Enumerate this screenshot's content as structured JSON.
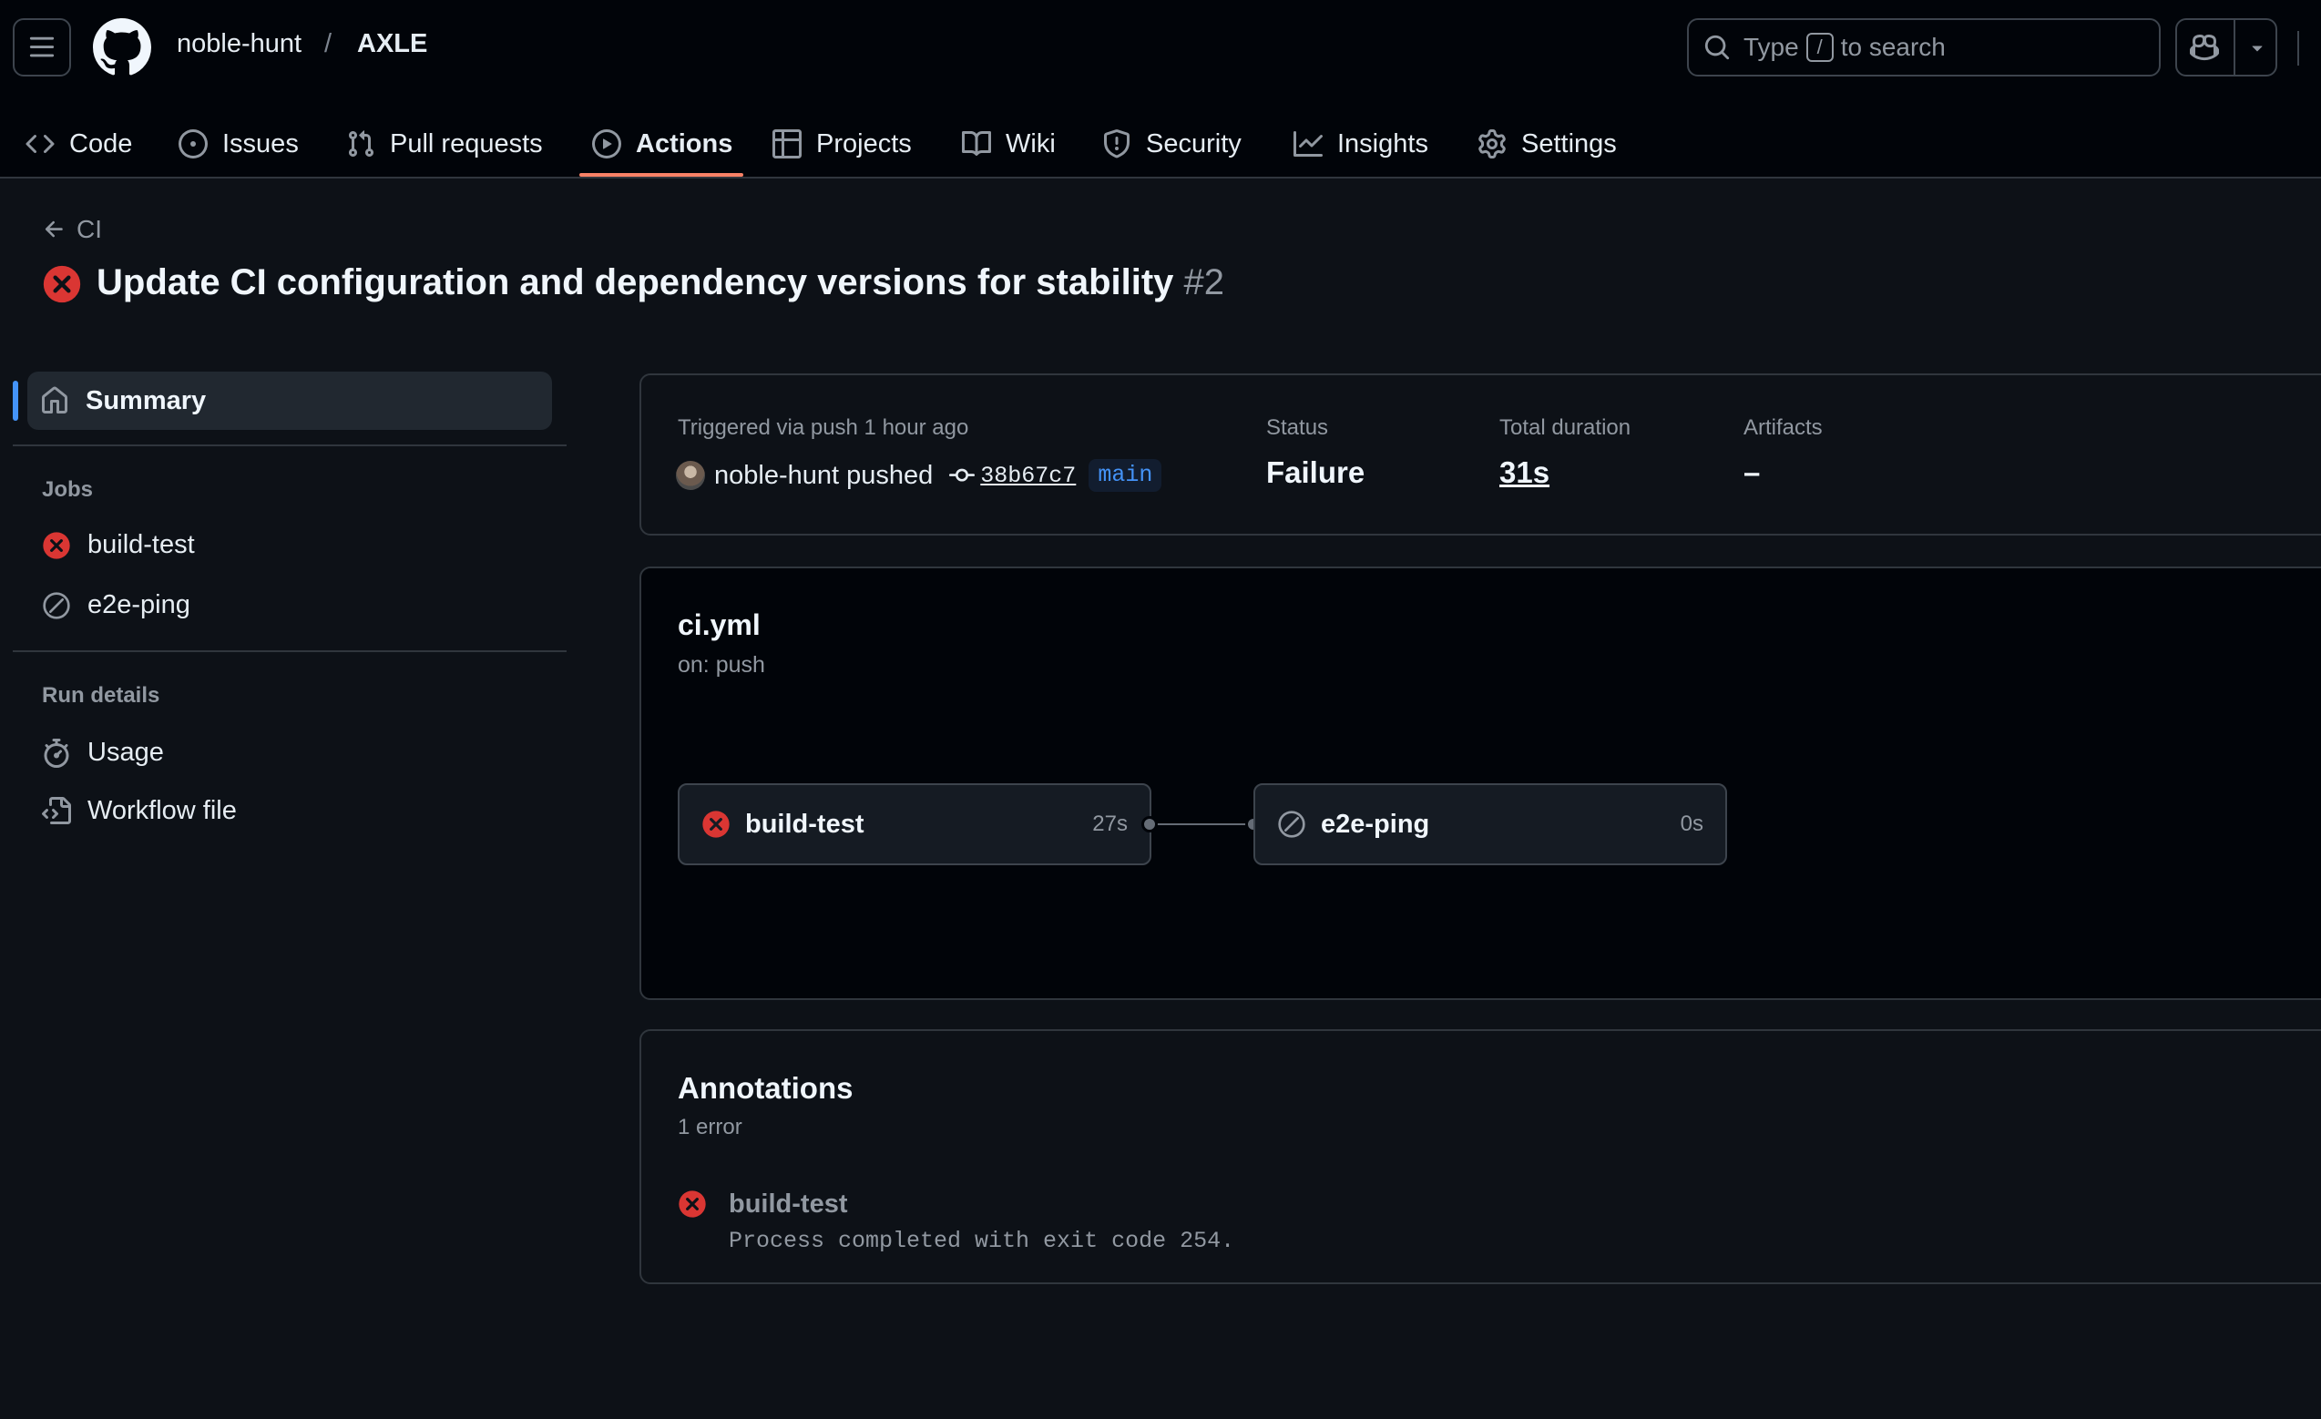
{
  "header": {
    "owner": "noble-hunt",
    "separator": "/",
    "repo": "AXLE",
    "search_text_before": "Type",
    "search_key": "/",
    "search_text_after": "to search"
  },
  "nav": {
    "tabs": [
      {
        "label": "Code",
        "icon": "code-icon"
      },
      {
        "label": "Issues",
        "icon": "issue-icon"
      },
      {
        "label": "Pull requests",
        "icon": "pull-request-icon"
      },
      {
        "label": "Actions",
        "icon": "play-icon",
        "active": true
      },
      {
        "label": "Projects",
        "icon": "table-icon"
      },
      {
        "label": "Wiki",
        "icon": "book-icon"
      },
      {
        "label": "Security",
        "icon": "shield-icon"
      },
      {
        "label": "Insights",
        "icon": "graph-icon"
      },
      {
        "label": "Settings",
        "icon": "gear-icon"
      }
    ]
  },
  "run": {
    "back_label": "CI",
    "title": "Update CI configuration and dependency versions for stability",
    "number": "#2"
  },
  "sidebar": {
    "summary": "Summary",
    "jobs_heading": "Jobs",
    "jobs": [
      {
        "label": "build-test",
        "status": "failure"
      },
      {
        "label": "e2e-ping",
        "status": "skipped"
      }
    ],
    "details_heading": "Run details",
    "details": [
      {
        "label": "Usage",
        "icon": "stopwatch-icon"
      },
      {
        "label": "Workflow file",
        "icon": "file-code-icon"
      }
    ]
  },
  "summary": {
    "triggered_label": "Triggered via push 1 hour ago",
    "pusher": "noble-hunt",
    "pushed_word": "pushed",
    "commit": "38b67c7",
    "branch": "main",
    "status_label": "Status",
    "status_value": "Failure",
    "duration_label": "Total duration",
    "duration_value": "31s",
    "artifacts_label": "Artifacts",
    "artifacts_value": "–"
  },
  "workflow": {
    "file": "ci.yml",
    "trigger": "on: push",
    "jobs": [
      {
        "name": "build-test",
        "duration": "27s",
        "status": "failure"
      },
      {
        "name": "e2e-ping",
        "duration": "0s",
        "status": "skipped"
      }
    ]
  },
  "annotations": {
    "title": "Annotations",
    "count": "1 error",
    "items": [
      {
        "job": "build-test",
        "message": "Process completed with exit code 254."
      }
    ]
  },
  "colors": {
    "background": "#0d1117",
    "header": "#010409",
    "border": "#30363d",
    "failure": "#da3633",
    "accent_underline": "#f78166",
    "link_blue": "#4493f8"
  }
}
